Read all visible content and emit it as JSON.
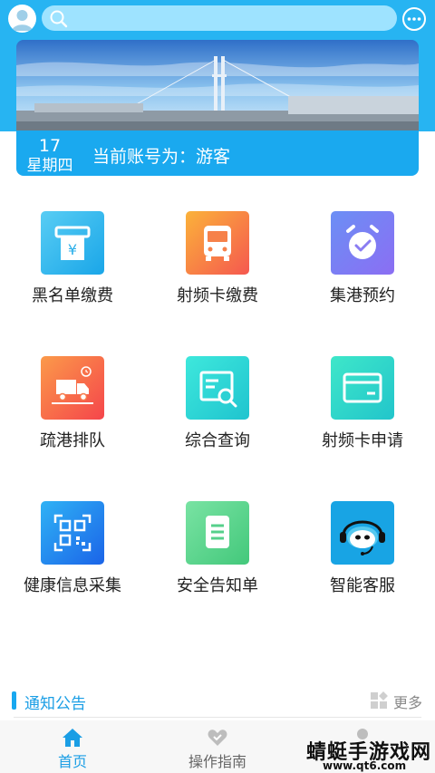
{
  "header": {
    "search_placeholder": ""
  },
  "banner": {
    "date_day": "17",
    "date_weekday": "星期四",
    "account_text": "当前账号为：游客"
  },
  "grid": [
    {
      "label": "黑名单缴费",
      "icon": "atm-yuan-icon",
      "color": "#34b5ec"
    },
    {
      "label": "射频卡缴费",
      "icon": "bus-icon",
      "color": "#f7784a"
    },
    {
      "label": "集港预约",
      "icon": "alarm-clock-icon",
      "color": "#7f78f4"
    },
    {
      "label": "疏港排队",
      "icon": "truck-icon",
      "color": "#f86a4b"
    },
    {
      "label": "综合查询",
      "icon": "document-search-icon",
      "color": "#2ad6d4"
    },
    {
      "label": "射频卡申请",
      "icon": "card-icon",
      "color": "#27d5c6"
    },
    {
      "label": "健康信息采集",
      "icon": "qr-scan-icon",
      "color": "#2a8ef0"
    },
    {
      "label": "安全告知单",
      "icon": "document-icon",
      "color": "#5dd88c"
    },
    {
      "label": "智能客服",
      "icon": "customer-service-icon",
      "color": "#18a4e4"
    }
  ],
  "notice": {
    "title": "通知公告",
    "more": "更多"
  },
  "tabs": [
    {
      "label": "首页",
      "active": true
    },
    {
      "label": "操作指南",
      "active": false
    },
    {
      "label": "",
      "active": false
    }
  ],
  "watermark": {
    "text": "蜻蜓手游戏网",
    "url": "www.qt6.com"
  }
}
